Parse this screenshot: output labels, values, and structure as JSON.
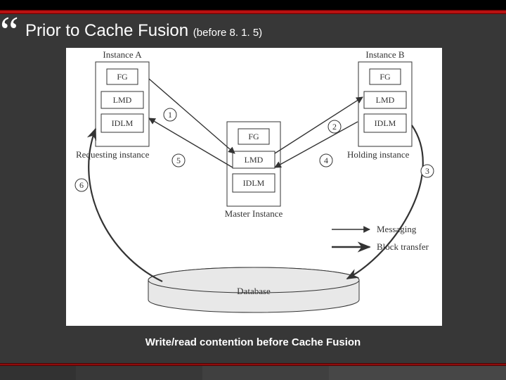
{
  "quote_glyph": "“",
  "title": "Prior to Cache Fusion",
  "title_sub": "(before 8. 1. 5)",
  "caption": "Write/read contention before Cache Fusion",
  "diagram": {
    "instanceA": {
      "header": "Instance A",
      "fg": "FG",
      "lmd": "LMD",
      "idlm": "IDLM",
      "role": "Requesting instance"
    },
    "instanceB": {
      "header": "Instance B",
      "fg": "FG",
      "lmd": "LMD",
      "idlm": "IDLM",
      "role": "Holding instance"
    },
    "master": {
      "header": "Master Instance",
      "fg": "FG",
      "lmd": "LMD",
      "idlm": "IDLM"
    },
    "steps": {
      "s1": "1",
      "s2": "2",
      "s3": "3",
      "s4": "4",
      "s5": "5",
      "s6": "6"
    },
    "legend": {
      "messaging": "Messaging",
      "block": "Block transfer"
    },
    "database": "Database"
  }
}
